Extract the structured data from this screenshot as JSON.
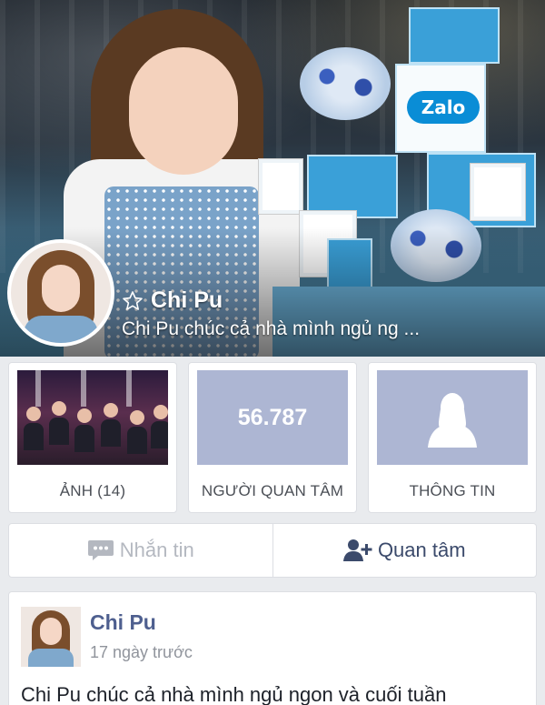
{
  "profile": {
    "name": "Chi Pu",
    "status": "Chi Pu chúc cả nhà mình ngủ ng ..."
  },
  "cover": {
    "zalo_logo_text": "Zalo"
  },
  "tiles": {
    "photos_label": "ẢNH (14)",
    "followers_count": "56.787",
    "followers_label": "NGƯỜI QUAN TÂM",
    "info_label": "THÔNG TIN"
  },
  "actions": {
    "message_label": "Nhắn tin",
    "follow_label": "Quan tâm"
  },
  "post": {
    "author": "Chi Pu",
    "time": "17 ngày trước",
    "text": "Chi Pu chúc cả nhà mình ngủ ngon và cuối tuần"
  },
  "icons": {
    "star": "star-outline-icon",
    "message": "chat-bubble-icon",
    "follow": "add-person-icon",
    "info": "person-silhouette-icon"
  },
  "colors": {
    "tile_placeholder": "#adb6d3",
    "author_link": "#4e5f8f",
    "follow_text": "#3b4a6b"
  }
}
